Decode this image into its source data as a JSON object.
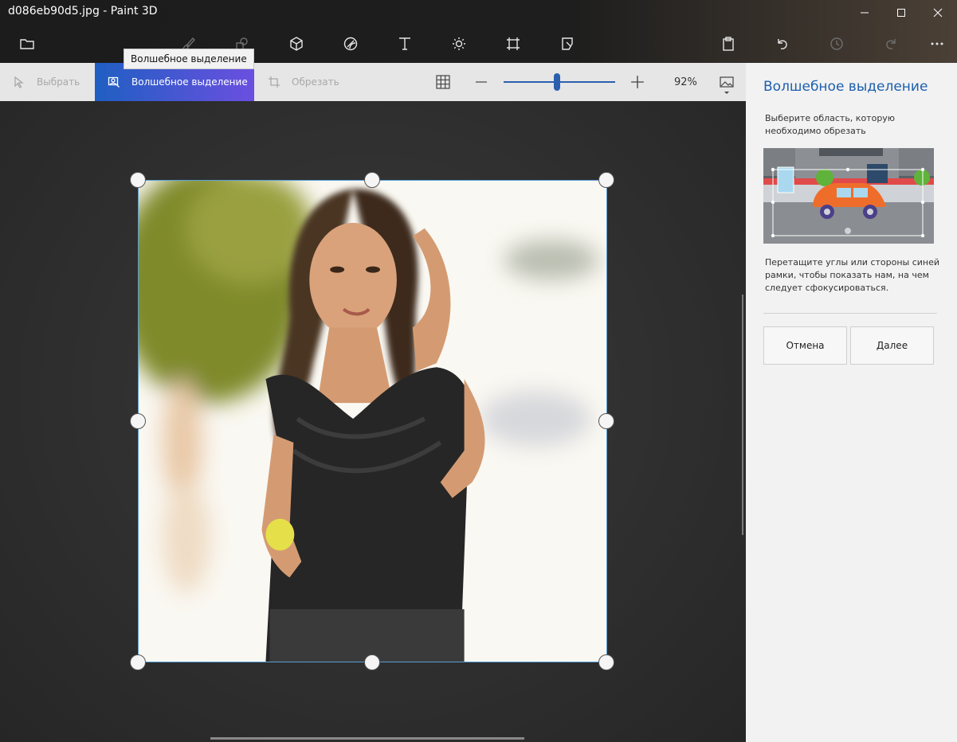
{
  "window": {
    "title": "d086eb90d5.jpg - Paint 3D"
  },
  "toolbar": {
    "icons": [
      "menu-folder-icon",
      "brushes-icon",
      "2d-shapes-icon",
      "3d-shapes-icon",
      "stickers-icon",
      "text-icon",
      "effects-icon",
      "canvas-icon",
      "3d-library-icon",
      "paste-icon",
      "undo-icon",
      "history-icon",
      "redo-icon",
      "more-icon"
    ]
  },
  "tooltip": "Волшебное выделение",
  "subbar": {
    "select_label": "Выбрать",
    "magic_select_label": "Волшебное выделение",
    "crop_label": "Обрезать",
    "zoom": {
      "value_label": "92%",
      "level": 0.48
    }
  },
  "panel": {
    "title": "Волшебное выделение",
    "description": "Выберите область, которую необходимо обрезать",
    "hint": "Перетащите углы или стороны синей рамки, чтобы показать нам, на чем следует сфокусироваться.",
    "cancel_label": "Отмена",
    "next_label": "Далее"
  },
  "colors": {
    "accent": "#1d5fae",
    "active_tool_start": "#1f5fc2",
    "active_tool_end": "#6b4fe0",
    "selection_border": "#5aa0d8"
  }
}
